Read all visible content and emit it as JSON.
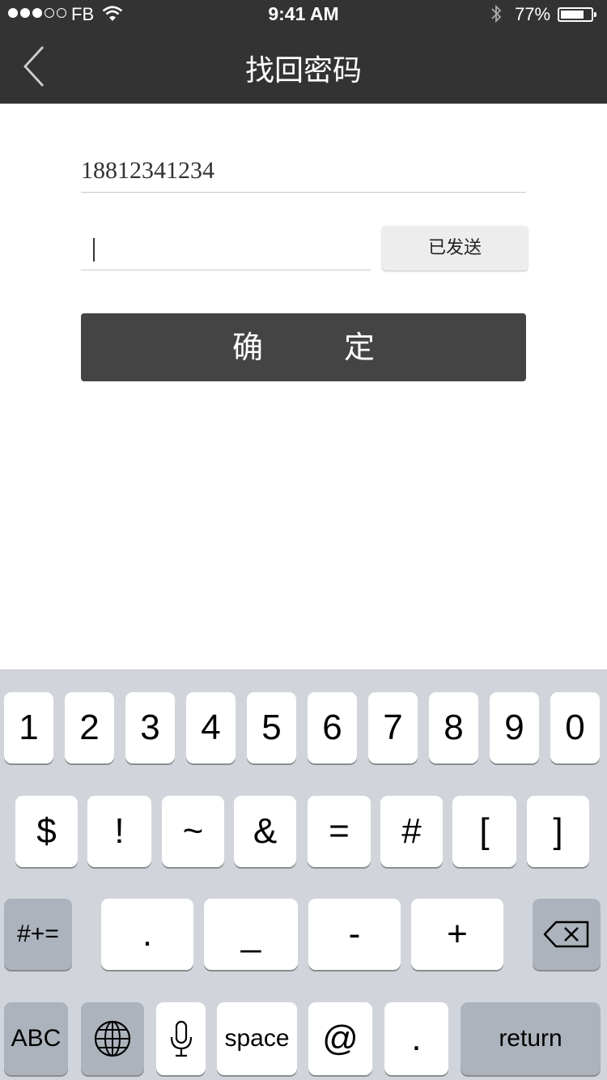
{
  "status_bar": {
    "carrier": "FB",
    "time": "9:41 AM",
    "battery_percent": "77%",
    "battery_level": 0.77,
    "signal_bars": 3
  },
  "nav": {
    "title": "找回密码",
    "back_icon": "chevron-left-icon"
  },
  "form": {
    "phone_value": "18812341234",
    "code_value": "",
    "send_button_label": "已发送",
    "confirm_label": "确定"
  },
  "keyboard": {
    "row1": [
      "1",
      "2",
      "3",
      "4",
      "5",
      "6",
      "7",
      "8",
      "9",
      "0"
    ],
    "row2": [
      "$",
      "!",
      "~",
      "&",
      "=",
      "#",
      "[",
      "]"
    ],
    "row3": [
      ".",
      "_",
      "-",
      "+"
    ],
    "toggle_symbols": "#+=",
    "toggle_abc": "ABC",
    "space": "space",
    "at": "@",
    "period": ".",
    "return": "return",
    "icons": [
      "delete-icon",
      "globe-icon",
      "microphone-icon"
    ]
  },
  "colors": {
    "header_bg": "#333333",
    "confirm_bg": "#444444",
    "keyboard_bg": "#d1d5db"
  }
}
